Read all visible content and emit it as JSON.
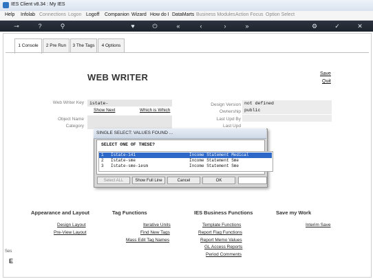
{
  "window": {
    "title": "IES Client v8.34 : My IES"
  },
  "menu": {
    "items": [
      {
        "label": "Help",
        "enabled": true
      },
      {
        "label": "Infolab",
        "enabled": true
      },
      {
        "label": "Connections",
        "enabled": false
      },
      {
        "label": "Logon",
        "enabled": false
      },
      {
        "label": "Logoff",
        "enabled": true
      },
      {
        "label": "Companion",
        "enabled": true
      },
      {
        "label": "Wizard",
        "enabled": true
      },
      {
        "label": "How do I",
        "enabled": true
      },
      {
        "label": "DataMarts",
        "enabled": true
      },
      {
        "label": "Business Modules",
        "enabled": false
      },
      {
        "label": "Action Focus",
        "enabled": false
      },
      {
        "label": "Option Select",
        "enabled": false
      }
    ]
  },
  "toolbar": {
    "icons": [
      "key-icon",
      "help-icon",
      "search-icon",
      "heart-icon",
      "power-icon",
      "rewind-icon",
      "back-icon",
      "forward-icon",
      "fast-forward-icon",
      "gear-icon",
      "check-icon",
      "close-icon"
    ]
  },
  "tabs": [
    {
      "label": "1 Console"
    },
    {
      "label": "2 Pre Run"
    },
    {
      "label": "3 The Tags"
    },
    {
      "label": "4 Options"
    }
  ],
  "page": {
    "title": "WEB WRITER",
    "save": "Save",
    "quit": "Quit"
  },
  "form": {
    "key_label": "Web Writer Key",
    "key_value": "istate-",
    "show_next": "Show Next",
    "which_is_which": "Which is Which",
    "object_name_label": "Object Name",
    "category_label": "Category",
    "design_version_label": "Design Version",
    "design_version_value": "not defined",
    "ownership_label": "Ownership",
    "ownership_value": "public",
    "last_upd_by_label": "Last Upd By",
    "last_upd_label": "Last Upd"
  },
  "dialog": {
    "title": "SINGLE SELECT: VALUES FOUND ...",
    "prompt": "SELECT ONE OF THESE?",
    "rows": [
      {
        "num": "1",
        "code": "Istate-141",
        "desc": "Income Statement Medical",
        "selected": true
      },
      {
        "num": "2",
        "code": "Istate-sme",
        "desc": "Income Statement Sme",
        "selected": false
      },
      {
        "num": "3",
        "code": "Istate-sme-iesm",
        "desc": "Income Statement Sme",
        "selected": false
      }
    ],
    "buttons": {
      "select_all": "Select ALL",
      "show_full_line": "Show Full Line",
      "cancel": "Cancel",
      "ok": "OK"
    }
  },
  "groups": {
    "appearance": {
      "heading": "Appearance and Layout",
      "links": [
        "Design Layout",
        "Pre-View Layout"
      ]
    },
    "tag": {
      "heading": "Tag Functions",
      "links": [
        "Iterative Units",
        "Find New Tags",
        "Mass Edit Tag Names"
      ]
    },
    "ies": {
      "heading": "IES Business Functions",
      "links": [
        "Template Functions",
        "Report Flag Functions",
        "Report Memo Values",
        "GL Access Reports",
        "Period Comments"
      ]
    },
    "save": {
      "heading": "Save my Work",
      "links": [
        "Interim Save"
      ]
    }
  },
  "side": {
    "ses_label": "Ses",
    "e_label": "E"
  },
  "colors": {
    "selection": "#2d67c7",
    "toolbar": "#1d232c"
  }
}
